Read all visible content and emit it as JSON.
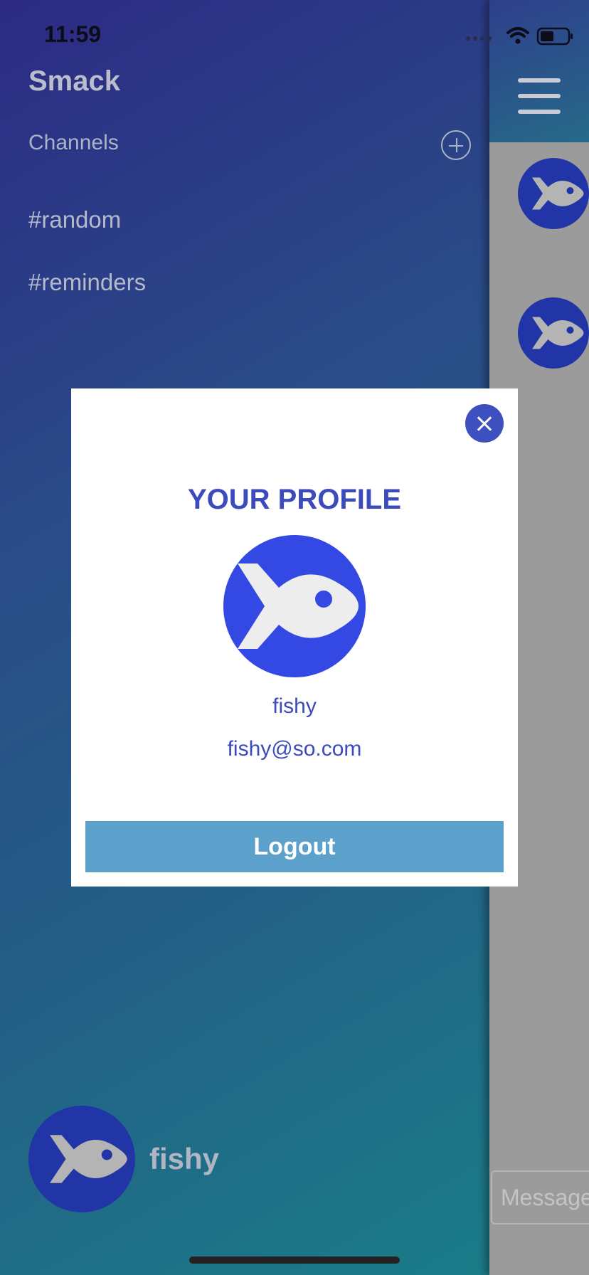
{
  "status_bar": {
    "time": "11:59"
  },
  "sidebar": {
    "app_title": "Smack",
    "channels_label": "Channels",
    "channels": [
      "#random",
      "#reminders"
    ],
    "user_name": "fishy"
  },
  "main": {
    "message_placeholder": "Message"
  },
  "modal": {
    "title": "YOUR PROFILE",
    "name": "fishy",
    "email": "fishy@so.com",
    "logout_label": "Logout"
  },
  "colors": {
    "accent": "#3b4bbb",
    "avatar_bg": "#3448e4",
    "logout_bg": "#5ba1cb"
  },
  "icons": [
    "add-icon",
    "menu-icon",
    "close-icon",
    "fish-icon",
    "wifi-icon",
    "battery-icon"
  ]
}
